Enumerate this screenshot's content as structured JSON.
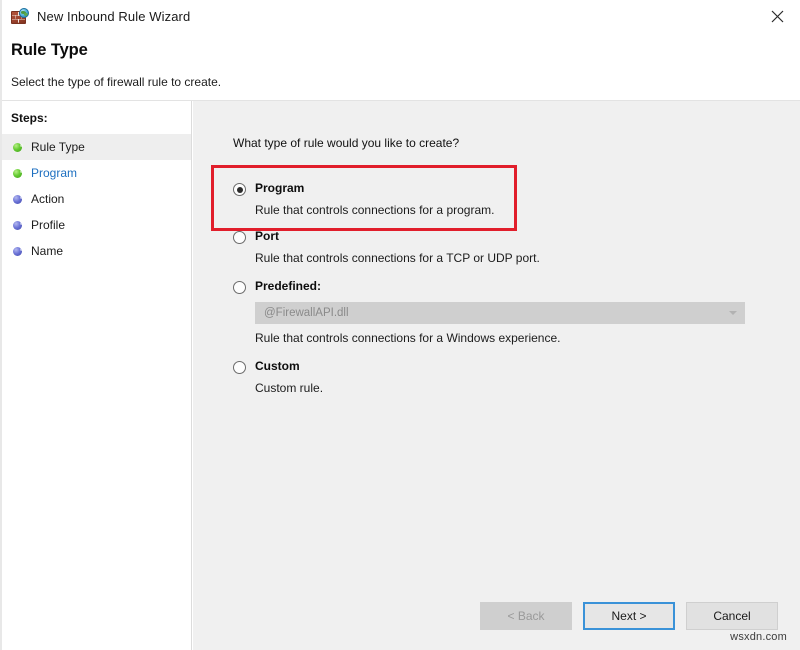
{
  "window": {
    "title": "New Inbound Rule Wizard",
    "app_icon": "firewall-globe-icon",
    "close_label": "×"
  },
  "header": {
    "title": "Rule Type",
    "subtitle": "Select the type of firewall rule to create."
  },
  "sidebar": {
    "label": "Steps:",
    "items": [
      {
        "label": "Rule Type",
        "state": "done",
        "highlighted": true
      },
      {
        "label": "Program",
        "state": "done",
        "highlighted": false
      },
      {
        "label": "Action",
        "state": "pending",
        "highlighted": false
      },
      {
        "label": "Profile",
        "state": "pending",
        "highlighted": false
      },
      {
        "label": "Name",
        "state": "pending",
        "highlighted": false
      }
    ]
  },
  "main": {
    "question": "What type of rule would you like to create?",
    "options": [
      {
        "id": "program",
        "title": "Program",
        "description": "Rule that controls connections for a program.",
        "selected": true,
        "highlighted": true
      },
      {
        "id": "port",
        "title": "Port",
        "description": "Rule that controls connections for a TCP or UDP port.",
        "selected": false,
        "highlighted": false
      },
      {
        "id": "predefined",
        "title": "Predefined:",
        "description": "Rule that controls connections for a Windows experience.",
        "selected": false,
        "highlighted": false,
        "combo_value": "@FirewallAPI.dll",
        "combo_disabled": true
      },
      {
        "id": "custom",
        "title": "Custom",
        "description": "Custom rule.",
        "selected": false,
        "highlighted": false
      }
    ]
  },
  "footer": {
    "back_label": "< Back",
    "next_label": "Next >",
    "cancel_label": "Cancel",
    "back_disabled": true,
    "next_is_default": true
  },
  "watermark": "wsxdn.com",
  "colors": {
    "highlight_red": "#e11e2b",
    "focus_blue": "#3a92d8",
    "current_step_blue": "#1d6fc0",
    "step_done_green": "#66cc33",
    "step_pending_blue": "#6a72d6",
    "content_background": "#f0f0f0"
  }
}
